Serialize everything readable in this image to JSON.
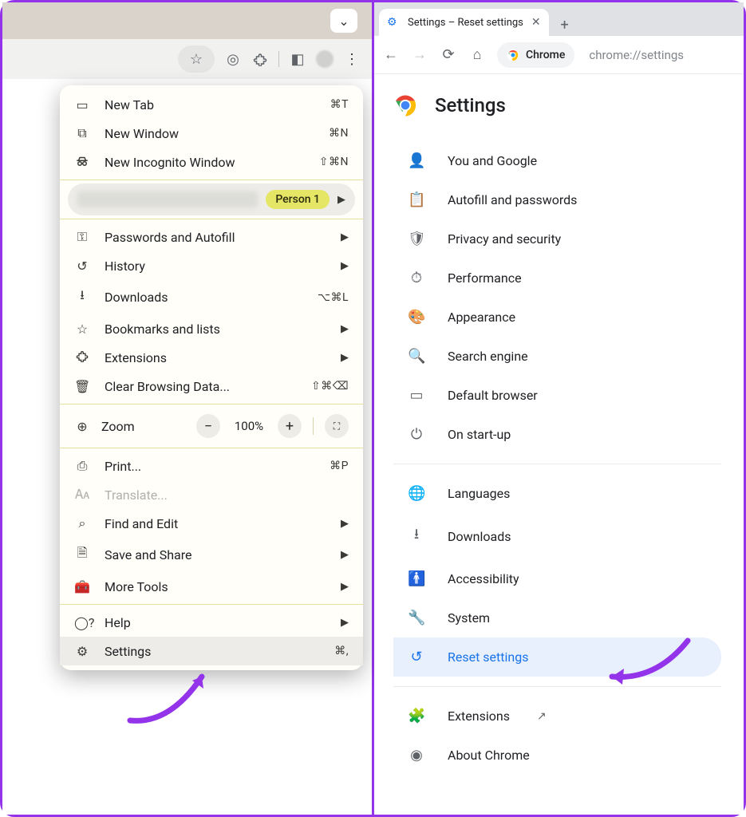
{
  "left": {
    "menu": {
      "new_tab": "New Tab",
      "new_tab_sc": "⌘T",
      "new_window": "New Window",
      "new_window_sc": "⌘N",
      "new_incognito": "New Incognito Window",
      "new_incognito_sc": "⇧⌘N",
      "person_chip": "Person 1",
      "passwords": "Passwords and Autofill",
      "history": "History",
      "downloads": "Downloads",
      "downloads_sc": "⌥⌘L",
      "bookmarks": "Bookmarks and lists",
      "extensions": "Extensions",
      "clear": "Clear Browsing Data...",
      "clear_sc": "⇧⌘⌫",
      "zoom": "Zoom",
      "zoom_val": "100%",
      "print": "Print...",
      "print_sc": "⌘P",
      "translate": "Translate...",
      "find": "Find and Edit",
      "save": "Save and Share",
      "more": "More Tools",
      "help": "Help",
      "settings": "Settings",
      "settings_sc": "⌘,"
    }
  },
  "right": {
    "tab_title": "Settings – Reset settings",
    "addr_label": "Chrome",
    "addr_url": "chrome://settings",
    "page_title": "Settings",
    "items": {
      "you": "You and Google",
      "autofill": "Autofill and passwords",
      "privacy": "Privacy and security",
      "performance": "Performance",
      "appearance": "Appearance",
      "search": "Search engine",
      "default_browser": "Default browser",
      "startup": "On start-up",
      "languages": "Languages",
      "downloads": "Downloads",
      "accessibility": "Accessibility",
      "system": "System",
      "reset": "Reset settings",
      "extensions": "Extensions",
      "about": "About Chrome"
    }
  }
}
